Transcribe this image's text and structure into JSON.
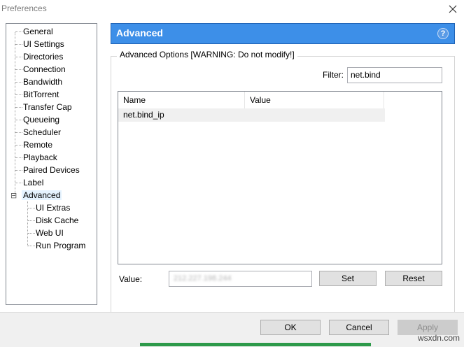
{
  "window": {
    "title": "Preferences"
  },
  "sidebar": {
    "items": [
      {
        "label": "General"
      },
      {
        "label": "UI Settings"
      },
      {
        "label": "Directories"
      },
      {
        "label": "Connection"
      },
      {
        "label": "Bandwidth"
      },
      {
        "label": "BitTorrent"
      },
      {
        "label": "Transfer Cap"
      },
      {
        "label": "Queueing"
      },
      {
        "label": "Scheduler"
      },
      {
        "label": "Remote"
      },
      {
        "label": "Playback"
      },
      {
        "label": "Paired Devices"
      },
      {
        "label": "Label"
      },
      {
        "label": "Advanced",
        "selected": true,
        "expanded": true
      }
    ],
    "children": [
      {
        "label": "UI Extras"
      },
      {
        "label": "Disk Cache"
      },
      {
        "label": "Web UI"
      },
      {
        "label": "Run Program"
      }
    ],
    "expand_glyph": "⊟"
  },
  "panel": {
    "header_title": "Advanced",
    "help_icon": "?",
    "group_title": "Advanced Options [WARNING: Do not modify!]",
    "filter": {
      "label": "Filter:",
      "value": "net.bind"
    },
    "table": {
      "columns": [
        "Name",
        "Value"
      ],
      "rows": [
        {
          "name": "net.bind_ip",
          "value": ""
        }
      ]
    },
    "value": {
      "label": "Value:",
      "current": "212.227.198.244"
    },
    "set_label": "Set",
    "reset_label": "Reset"
  },
  "footer": {
    "ok_label": "OK",
    "cancel_label": "Cancel",
    "apply_label": "Apply",
    "apply_disabled": true
  },
  "watermark": "wsxdn.com",
  "colors": {
    "header": "#3d8fe8",
    "selected_row": "#f0f0f0"
  }
}
